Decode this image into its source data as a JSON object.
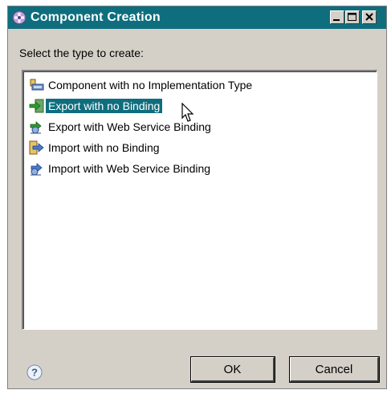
{
  "window": {
    "title": "Component Creation",
    "controls": {
      "minimize": "minimize-icon",
      "maximize": "maximize-icon",
      "close": "close-icon"
    }
  },
  "prompt": "Select the type to create:",
  "types": [
    {
      "label": "Component with no Implementation Type",
      "icon": "component-icon",
      "selected": false
    },
    {
      "label": "Export with no Binding",
      "icon": "export-icon",
      "selected": true
    },
    {
      "label": "Export with Web Service Binding",
      "icon": "export-web-service-icon",
      "selected": false
    },
    {
      "label": "Import with no Binding",
      "icon": "import-icon",
      "selected": false
    },
    {
      "label": "Import with Web Service Binding",
      "icon": "import-web-service-icon",
      "selected": false
    }
  ],
  "buttons": {
    "ok": "OK",
    "cancel": "Cancel"
  },
  "colors": {
    "title_bar": "#0f6e7e",
    "selection": "#0f6e7e",
    "dialog_face": "#d4d0c8"
  }
}
